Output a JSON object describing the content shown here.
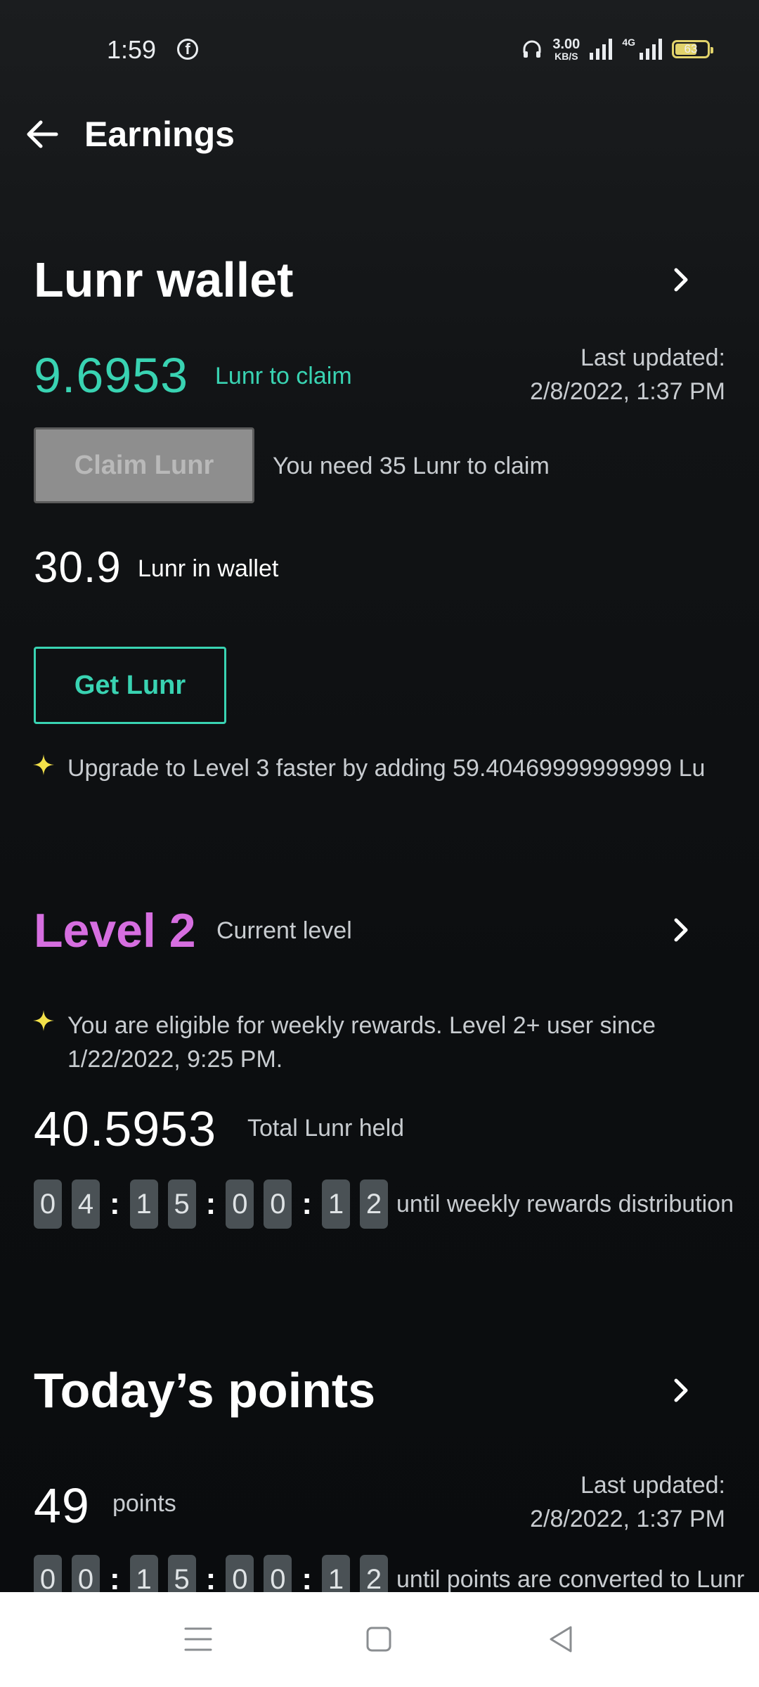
{
  "status_bar": {
    "time": "1:59",
    "net_speed_value": "3.00",
    "net_speed_unit": "KB/S",
    "network": "4G",
    "battery": "63"
  },
  "header": {
    "title": "Earnings"
  },
  "wallet": {
    "title": "Lunr wallet",
    "claimable_amount": "9.6953",
    "claimable_label": "Lunr to claim",
    "last_updated_label": "Last updated:",
    "last_updated_value": "2/8/2022, 1:37 PM",
    "claim_button": "Claim Lunr",
    "claim_hint": "You need 35 Lunr to claim",
    "wallet_amount": "30.9",
    "wallet_label": "Lunr in wallet",
    "get_button": "Get Lunr",
    "upgrade_tip": "Upgrade to Level 3 faster by adding 59.40469999999999 Lu"
  },
  "level": {
    "title": "Level 2",
    "subtitle": "Current level",
    "tip_line1": "You are eligible for weekly rewards. Level 2+ user since",
    "tip_line2": "1/22/2022, 9:25 PM.",
    "total_amount": "40.5953",
    "total_label": "Total Lunr held",
    "countdown": [
      "0",
      "4",
      "1",
      "5",
      "0",
      "0",
      "1",
      "2"
    ],
    "countdown_label": "until weekly rewards distribution"
  },
  "points": {
    "title": "Today’s points",
    "amount": "49",
    "label": "points",
    "last_updated_label": "Last updated:",
    "last_updated_value": "2/8/2022, 1:37 PM",
    "countdown": [
      "0",
      "0",
      "1",
      "5",
      "0",
      "0",
      "1",
      "2"
    ],
    "countdown_label": "until points are converted to Lunr"
  },
  "colors": {
    "accent_mint": "#39d3b2",
    "level_purple": "#d66ee0",
    "sparkle_yellow": "#f3e14a"
  }
}
